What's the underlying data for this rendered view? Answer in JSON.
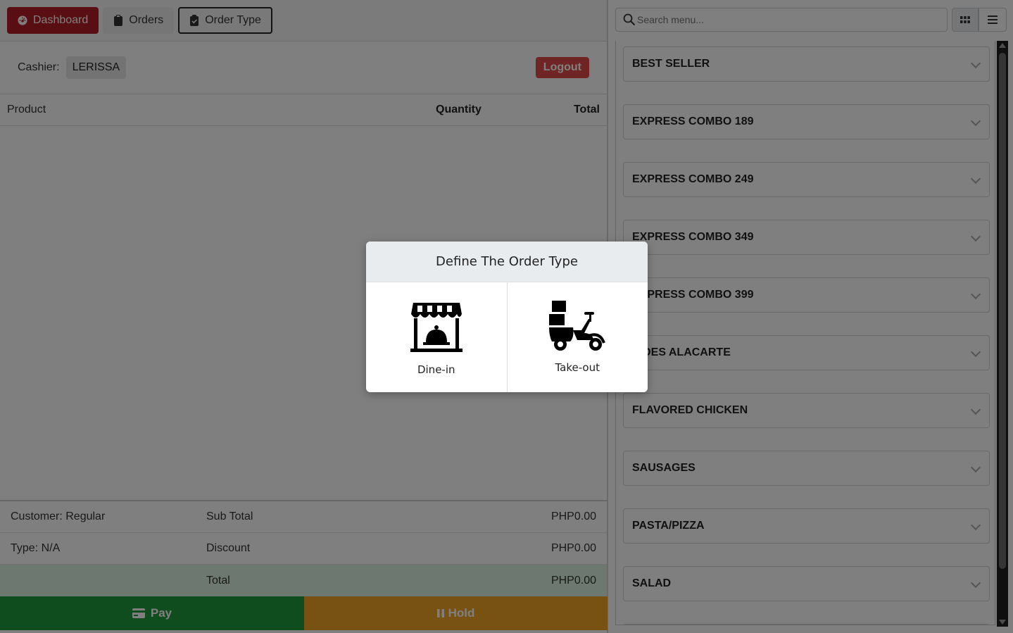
{
  "nav": {
    "dashboard_label": "Dashboard",
    "orders_label": "Orders",
    "order_type_label": "Order Type"
  },
  "cashier": {
    "label": "Cashier:",
    "name": "LERISSA",
    "logout_label": "Logout"
  },
  "order_table": {
    "columns": [
      "Product",
      "Quantity",
      "Total"
    ]
  },
  "summary": {
    "customer": "Customer: Regular",
    "type": "Type: N/A",
    "subtotal_label": "Sub Total",
    "subtotal_value": "PHP0.00",
    "discount_label": "Discount",
    "discount_value": "PHP0.00",
    "total_label": "Total",
    "total_value": "PHP0.00"
  },
  "actions": {
    "pay_label": "Pay",
    "hold_label": "Hold"
  },
  "search": {
    "placeholder": "Search menu..."
  },
  "categories": [
    "BEST SELLER",
    "EXPRESS COMBO 189",
    "EXPRESS COMBO 249",
    "EXPRESS COMBO 349",
    "EXPRESS COMBO 399",
    "SIDES ALACARTE",
    "FLAVORED CHICKEN",
    "SAUSAGES",
    "PASTA/PIZZA",
    "SALAD"
  ],
  "modal": {
    "title": "Define The Order Type",
    "options": [
      {
        "label": "Dine-in",
        "icon": "store-icon"
      },
      {
        "label": "Take-out",
        "icon": "scooter-delivery-icon"
      }
    ]
  },
  "colors": {
    "dashboard_red": "#b01c24",
    "logout_red": "#e04b4b",
    "pay_green": "#1e9a3f",
    "hold_orange": "#f0a424",
    "total_row_bg": "#d8f0e0"
  }
}
